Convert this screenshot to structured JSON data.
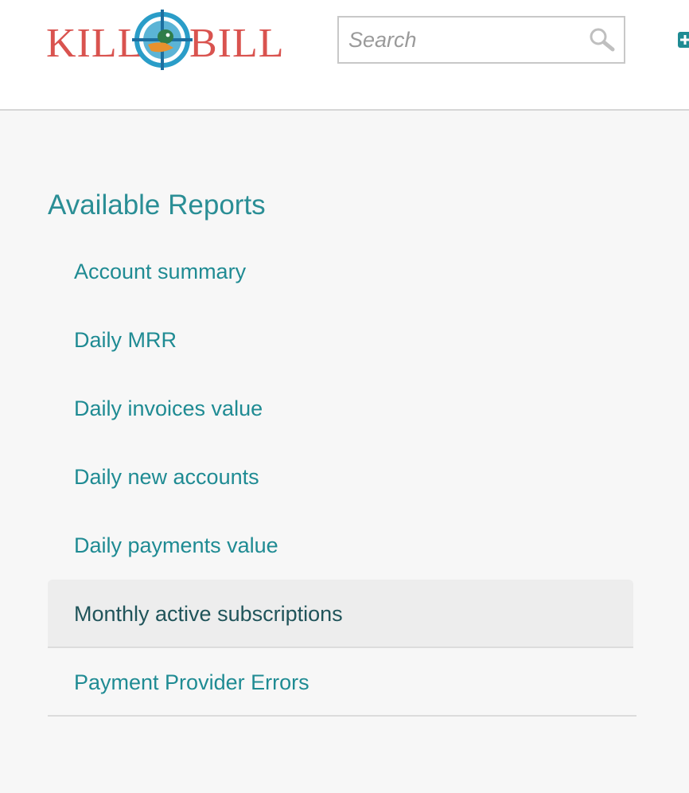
{
  "header": {
    "logo": {
      "text_left": "KILL",
      "text_right": "BILL",
      "brand_color": "#d9534f",
      "target_color": "#2a9dc8"
    },
    "search": {
      "placeholder": "Search",
      "value": "",
      "icon": "search-icon"
    },
    "add_icon": "plus-square-icon",
    "accent_color": "#1f8b93"
  },
  "main": {
    "title": "Available Reports",
    "reports": [
      {
        "label": "Account summary",
        "active": false
      },
      {
        "label": "Daily MRR",
        "active": false
      },
      {
        "label": "Daily invoices value",
        "active": false
      },
      {
        "label": "Daily new accounts",
        "active": false
      },
      {
        "label": "Daily payments value",
        "active": false
      },
      {
        "label": "Monthly active subscriptions",
        "active": true
      },
      {
        "label": "Payment Provider Errors",
        "active": false
      }
    ]
  }
}
